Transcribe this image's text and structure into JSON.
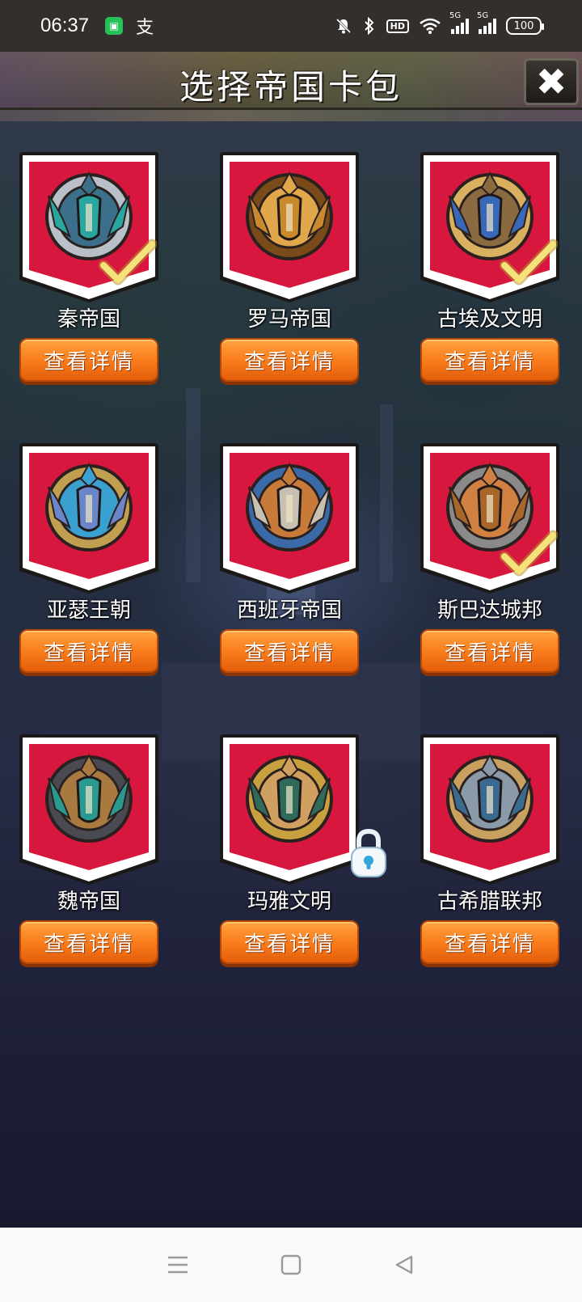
{
  "status_bar": {
    "time": "06:37",
    "alipay_glyph": "支",
    "hd_label": "HD",
    "network_1": "5G",
    "network_2": "5G",
    "battery": "100",
    "icons": [
      "app-badge-icon",
      "alipay-icon",
      "mute-bell-icon",
      "bluetooth-icon",
      "hd-icon",
      "wifi-icon",
      "signal-icon",
      "signal-icon",
      "battery-icon"
    ]
  },
  "header": {
    "title": "选择帝国卡包",
    "close_glyph": "✖"
  },
  "colors": {
    "card_red": "#d8173e",
    "button_orange": "#f97e1d",
    "check_yellow": "#f6e27a",
    "lock_blue": "#36a6d8"
  },
  "empires": [
    {
      "name": "秦帝国",
      "button": "查看详情",
      "selected": true,
      "locked": false,
      "emblem": "winged-sword-emblem"
    },
    {
      "name": "罗马帝国",
      "button": "查看详情",
      "selected": false,
      "locked": false,
      "emblem": "roman-helmet-emblem"
    },
    {
      "name": "古埃及文明",
      "button": "查看详情",
      "selected": true,
      "locked": false,
      "emblem": "eye-pyramid-emblem"
    },
    {
      "name": "亚瑟王朝",
      "button": "查看详情",
      "selected": false,
      "locked": false,
      "emblem": "winged-shield-emblem"
    },
    {
      "name": "西班牙帝国",
      "button": "查看详情",
      "selected": false,
      "locked": false,
      "emblem": "cross-shield-emblem"
    },
    {
      "name": "斯巴达城邦",
      "button": "查看详情",
      "selected": true,
      "locked": false,
      "emblem": "spartan-helmet-emblem"
    },
    {
      "name": "魏帝国",
      "button": "查看详情",
      "selected": false,
      "locked": false,
      "emblem": "horse-head-emblem"
    },
    {
      "name": "玛雅文明",
      "button": "查看详情",
      "selected": false,
      "locked": true,
      "emblem": "maya-mask-emblem"
    },
    {
      "name": "古希腊联邦",
      "button": "查看详情",
      "selected": false,
      "locked": false,
      "emblem": "greek-helmet-emblem"
    }
  ],
  "nav_bar": {
    "icons": [
      "menu-icon",
      "home-icon",
      "back-icon"
    ]
  }
}
